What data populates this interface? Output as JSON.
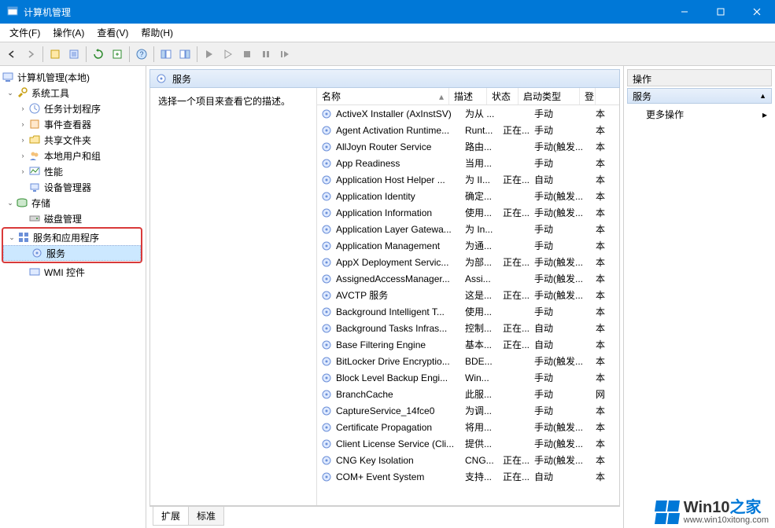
{
  "window": {
    "title": "计算机管理"
  },
  "menubar": [
    {
      "label": "文件(F)"
    },
    {
      "label": "操作(A)"
    },
    {
      "label": "查看(V)"
    },
    {
      "label": "帮助(H)"
    }
  ],
  "tree": {
    "root": "计算机管理(本地)",
    "system_tools": "系统工具",
    "task_scheduler": "任务计划程序",
    "event_viewer": "事件查看器",
    "shared_folders": "共享文件夹",
    "local_users": "本地用户和组",
    "performance": "性能",
    "device_manager": "设备管理器",
    "storage": "存储",
    "disk_mgmt": "磁盘管理",
    "services_apps": "服务和应用程序",
    "services": "服务",
    "wmi": "WMI 控件"
  },
  "services_panel": {
    "header": "服务",
    "prompt": "选择一个项目来查看它的描述。",
    "columns": {
      "name": "名称",
      "desc": "描述",
      "status": "状态",
      "startup": "启动类型",
      "logon": "登"
    },
    "rows": [
      {
        "name": "ActiveX Installer (AxInstSV)",
        "desc": "为从 ...",
        "status": "",
        "startup": "手动",
        "logon": "本"
      },
      {
        "name": "Agent Activation Runtime...",
        "desc": "Runt...",
        "status": "正在...",
        "startup": "手动",
        "logon": "本"
      },
      {
        "name": "AllJoyn Router Service",
        "desc": "路由...",
        "status": "",
        "startup": "手动(触发...",
        "logon": "本"
      },
      {
        "name": "App Readiness",
        "desc": "当用...",
        "status": "",
        "startup": "手动",
        "logon": "本"
      },
      {
        "name": "Application Host Helper ...",
        "desc": "为 II...",
        "status": "正在...",
        "startup": "自动",
        "logon": "本"
      },
      {
        "name": "Application Identity",
        "desc": "确定...",
        "status": "",
        "startup": "手动(触发...",
        "logon": "本"
      },
      {
        "name": "Application Information",
        "desc": "使用...",
        "status": "正在...",
        "startup": "手动(触发...",
        "logon": "本"
      },
      {
        "name": "Application Layer Gatewa...",
        "desc": "为 In...",
        "status": "",
        "startup": "手动",
        "logon": "本"
      },
      {
        "name": "Application Management",
        "desc": "为通...",
        "status": "",
        "startup": "手动",
        "logon": "本"
      },
      {
        "name": "AppX Deployment Servic...",
        "desc": "为部...",
        "status": "正在...",
        "startup": "手动(触发...",
        "logon": "本"
      },
      {
        "name": "AssignedAccessManager...",
        "desc": "Assi...",
        "status": "",
        "startup": "手动(触发...",
        "logon": "本"
      },
      {
        "name": "AVCTP 服务",
        "desc": "这是...",
        "status": "正在...",
        "startup": "手动(触发...",
        "logon": "本"
      },
      {
        "name": "Background Intelligent T...",
        "desc": "使用...",
        "status": "",
        "startup": "手动",
        "logon": "本"
      },
      {
        "name": "Background Tasks Infras...",
        "desc": "控制...",
        "status": "正在...",
        "startup": "自动",
        "logon": "本"
      },
      {
        "name": "Base Filtering Engine",
        "desc": "基本...",
        "status": "正在...",
        "startup": "自动",
        "logon": "本"
      },
      {
        "name": "BitLocker Drive Encryptio...",
        "desc": "BDE...",
        "status": "",
        "startup": "手动(触发...",
        "logon": "本"
      },
      {
        "name": "Block Level Backup Engi...",
        "desc": "Win...",
        "status": "",
        "startup": "手动",
        "logon": "本"
      },
      {
        "name": "BranchCache",
        "desc": "此服...",
        "status": "",
        "startup": "手动",
        "logon": "网"
      },
      {
        "name": "CaptureService_14fce0",
        "desc": "为调...",
        "status": "",
        "startup": "手动",
        "logon": "本"
      },
      {
        "name": "Certificate Propagation",
        "desc": "将用...",
        "status": "",
        "startup": "手动(触发...",
        "logon": "本"
      },
      {
        "name": "Client License Service (Cli...",
        "desc": "提供...",
        "status": "",
        "startup": "手动(触发...",
        "logon": "本"
      },
      {
        "name": "CNG Key Isolation",
        "desc": "CNG...",
        "status": "正在...",
        "startup": "手动(触发...",
        "logon": "本"
      },
      {
        "name": "COM+ Event System",
        "desc": "支持...",
        "status": "正在...",
        "startup": "自动",
        "logon": "本"
      }
    ]
  },
  "tabs": {
    "extended": "扩展",
    "standard": "标准"
  },
  "actions": {
    "header": "操作",
    "section": "服务",
    "more": "更多操作"
  },
  "watermark": {
    "brand_main": "Win10",
    "brand_suffix": "之家",
    "url": "www.win10xitong.com"
  }
}
